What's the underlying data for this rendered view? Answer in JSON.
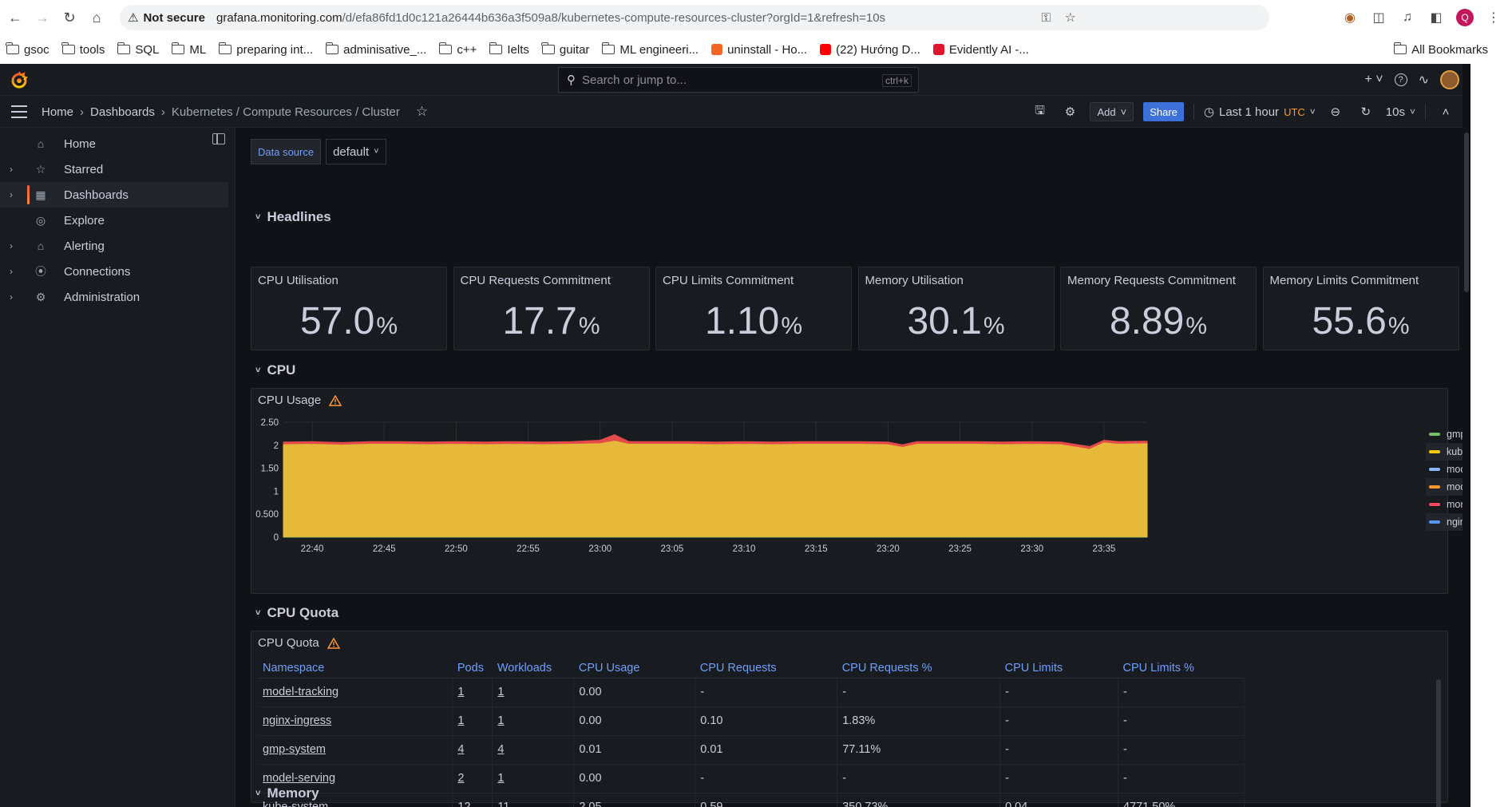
{
  "browser": {
    "security_label": "Not secure",
    "url_host": "grafana.monitoring.com",
    "url_path": "/d/efa86fd1d0c121a26444b636a3f509a8/kubernetes-compute-resources-cluster?orgId=1&refresh=10s",
    "profile_initial": "Q",
    "bookmarks": [
      {
        "label": "gsoc",
        "type": "folder"
      },
      {
        "label": "tools",
        "type": "folder"
      },
      {
        "label": "SQL",
        "type": "folder"
      },
      {
        "label": "ML",
        "type": "folder"
      },
      {
        "label": "preparing int...",
        "type": "folder"
      },
      {
        "label": "adminisative_...",
        "type": "folder"
      },
      {
        "label": "c++",
        "type": "folder"
      },
      {
        "label": "Ielts",
        "type": "folder"
      },
      {
        "label": "guitar",
        "type": "folder"
      },
      {
        "label": "ML engineeri...",
        "type": "folder"
      },
      {
        "label": "uninstall - Ho...",
        "type": "site",
        "color": "#f26522"
      },
      {
        "label": "(22) Hướng D...",
        "type": "site",
        "color": "#ff0000"
      },
      {
        "label": "Evidently AI -...",
        "type": "site",
        "color": "#e0162b"
      }
    ],
    "all_bookmarks": "All Bookmarks"
  },
  "grafana": {
    "search_placeholder": "Search or jump to...",
    "search_shortcut": "ctrl+k",
    "breadcrumb": [
      "Home",
      "Dashboards",
      "Kubernetes / Compute Resources / Cluster"
    ],
    "add_label": "Add",
    "share_label": "Share",
    "time_range": "Last 1 hour",
    "timezone": "UTC",
    "refresh": "10s",
    "nav": [
      {
        "label": "Home",
        "icon": "home-icon",
        "expandable": false,
        "active": false
      },
      {
        "label": "Starred",
        "icon": "star-icon",
        "expandable": true,
        "active": false
      },
      {
        "label": "Dashboards",
        "icon": "dashboards-icon",
        "expandable": true,
        "active": true
      },
      {
        "label": "Explore",
        "icon": "compass-icon",
        "expandable": false,
        "active": false
      },
      {
        "label": "Alerting",
        "icon": "bell-icon",
        "expandable": true,
        "active": false
      },
      {
        "label": "Connections",
        "icon": "connections-icon",
        "expandable": true,
        "active": false
      },
      {
        "label": "Administration",
        "icon": "gear-icon",
        "expandable": true,
        "active": false
      }
    ]
  },
  "dashboard": {
    "datasource_label": "Data source",
    "datasource_value": "default",
    "rows": {
      "headlines": "Headlines",
      "cpu": "CPU",
      "cpu_quota": "CPU Quota",
      "memory": "Memory"
    },
    "stats": [
      {
        "title": "CPU Utilisation",
        "value": "57.0",
        "unit": "%"
      },
      {
        "title": "CPU Requests Commitment",
        "value": "17.7",
        "unit": "%"
      },
      {
        "title": "CPU Limits Commitment",
        "value": "1.10",
        "unit": "%"
      },
      {
        "title": "Memory Utilisation",
        "value": "30.1",
        "unit": "%"
      },
      {
        "title": "Memory Requests Commitment",
        "value": "8.89",
        "unit": "%"
      },
      {
        "title": "Memory Limits Commitment",
        "value": "55.6",
        "unit": "%"
      }
    ],
    "cpu_usage_title": "CPU Usage",
    "cpu_quota_title": "CPU Quota",
    "quota_table": {
      "columns": [
        "Namespace",
        "Pods",
        "Workloads",
        "CPU Usage",
        "CPU Requests",
        "CPU Requests %",
        "CPU Limits",
        "CPU Limits %"
      ],
      "rows": [
        [
          "model-tracking",
          "1",
          "1",
          "0.00",
          "-",
          "-",
          "-",
          "-"
        ],
        [
          "nginx-ingress",
          "1",
          "1",
          "0.00",
          "0.10",
          "1.83%",
          "-",
          "-"
        ],
        [
          "gmp-system",
          "4",
          "4",
          "0.01",
          "0.01",
          "77.11%",
          "-",
          "-"
        ],
        [
          "model-serving",
          "2",
          "1",
          "0.00",
          "-",
          "-",
          "-",
          "-"
        ],
        [
          "kube-system",
          "12",
          "11",
          "2.05",
          "0.59",
          "350.73%",
          "0.04",
          "4771.50%"
        ]
      ]
    }
  },
  "chart_data": {
    "type": "area",
    "title": "CPU Usage",
    "x": [
      "22:38",
      "22:40",
      "22:42",
      "22:44",
      "22:46",
      "22:48",
      "22:50",
      "22:52",
      "22:54",
      "22:56",
      "22:58",
      "23:00",
      "23:01",
      "23:02",
      "23:04",
      "23:06",
      "23:08",
      "23:10",
      "23:12",
      "23:14",
      "23:16",
      "23:18",
      "23:20",
      "23:21",
      "23:22",
      "23:24",
      "23:26",
      "23:28",
      "23:30",
      "23:32",
      "23:34",
      "23:35",
      "23:36",
      "23:38"
    ],
    "x_ticks": [
      "22:40",
      "22:45",
      "22:50",
      "22:55",
      "23:00",
      "23:05",
      "23:10",
      "23:15",
      "23:20",
      "23:25",
      "23:30",
      "23:35"
    ],
    "ylim": [
      0,
      2.5
    ],
    "y_ticks": [
      "0",
      "0.500",
      "1",
      "1.50",
      "2",
      "2.50"
    ],
    "stacked": true,
    "legend_position": "right",
    "series": [
      {
        "name": "gmp-system",
        "color": "#73bf69",
        "values": [
          0.01,
          0.01,
          0.01,
          0.01,
          0.01,
          0.01,
          0.01,
          0.01,
          0.01,
          0.01,
          0.01,
          0.01,
          0.01,
          0.01,
          0.01,
          0.01,
          0.01,
          0.01,
          0.01,
          0.01,
          0.01,
          0.01,
          0.01,
          0.01,
          0.01,
          0.01,
          0.01,
          0.01,
          0.01,
          0.01,
          0.01,
          0.01,
          0.01,
          0.01
        ]
      },
      {
        "name": "kube-system",
        "color": "#f2cc0c",
        "values": [
          2.02,
          2.03,
          2.01,
          2.03,
          2.03,
          2.02,
          2.03,
          2.02,
          2.03,
          2.02,
          2.03,
          2.04,
          2.1,
          2.03,
          2.03,
          2.03,
          2.02,
          2.03,
          2.02,
          2.03,
          2.03,
          2.03,
          2.02,
          1.96,
          2.03,
          2.03,
          2.03,
          2.02,
          2.03,
          2.02,
          1.92,
          2.06,
          2.03,
          2.04
        ]
      },
      {
        "name": "model-serving",
        "color": "#8ab8ff",
        "values": [
          0,
          0,
          0,
          0,
          0,
          0,
          0,
          0,
          0,
          0,
          0,
          0,
          0,
          0,
          0,
          0,
          0,
          0,
          0,
          0,
          0,
          0,
          0,
          0,
          0,
          0,
          0,
          0,
          0,
          0,
          0,
          0,
          0,
          0
        ]
      },
      {
        "name": "model-tracking",
        "color": "#ff9830",
        "values": [
          0,
          0,
          0,
          0,
          0,
          0,
          0,
          0,
          0,
          0,
          0,
          0,
          0,
          0,
          0,
          0,
          0,
          0,
          0,
          0,
          0,
          0,
          0,
          0,
          0,
          0,
          0,
          0,
          0,
          0,
          0,
          0,
          0,
          0
        ]
      },
      {
        "name": "monitoring",
        "color": "#f2495c",
        "values": [
          0.04,
          0.04,
          0.04,
          0.04,
          0.04,
          0.04,
          0.04,
          0.04,
          0.04,
          0.04,
          0.04,
          0.06,
          0.12,
          0.04,
          0.04,
          0.04,
          0.04,
          0.04,
          0.04,
          0.04,
          0.04,
          0.04,
          0.04,
          0.04,
          0.04,
          0.04,
          0.04,
          0.04,
          0.04,
          0.04,
          0.04,
          0.04,
          0.04,
          0.04
        ]
      },
      {
        "name": "nginx-ingress",
        "color": "#5794f2",
        "values": [
          0,
          0,
          0,
          0,
          0,
          0,
          0,
          0,
          0,
          0,
          0,
          0,
          0,
          0,
          0,
          0,
          0,
          0,
          0,
          0,
          0,
          0,
          0,
          0,
          0,
          0,
          0,
          0,
          0,
          0,
          0,
          0,
          0,
          0
        ]
      }
    ]
  }
}
